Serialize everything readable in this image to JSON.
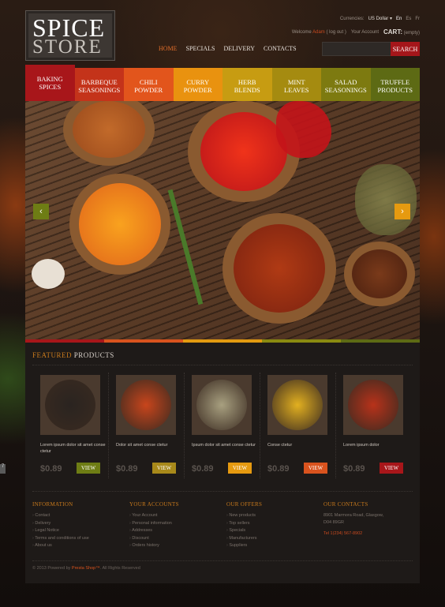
{
  "logo": {
    "line1": "SPICE",
    "line2": "STORE"
  },
  "topbar": {
    "currencies_label": "Currencies:",
    "currency_value": "US Dollar",
    "currency_chevron_icon": "chevron-down-icon",
    "languages": [
      "En",
      "Es",
      "Fr"
    ]
  },
  "userbar": {
    "welcome": "Welcome",
    "username": "Adam",
    "logout": "( log out )",
    "your_account": "Your Account",
    "cart_label": "CART:",
    "cart_state": "(empty)"
  },
  "nav": {
    "items": [
      "HOME",
      "SPECIALS",
      "DELIVERY",
      "CONTACTS"
    ],
    "active": "HOME"
  },
  "search": {
    "placeholder": "",
    "button": "SEARCH"
  },
  "categories": [
    {
      "line1": "BAKING",
      "line2": "SPICES",
      "color": "#a8161a"
    },
    {
      "line1": "BARBEQUE",
      "line2": "SEASONINGS",
      "color": "#c4331a"
    },
    {
      "line1": "CHILI",
      "line2": "POWDER",
      "color": "#e2551c"
    },
    {
      "line1": "CURRY",
      "line2": "POWDER",
      "color": "#e9920f"
    },
    {
      "line1": "HERB",
      "line2": "BLENDS",
      "color": "#c79c12"
    },
    {
      "line1": "MINT",
      "line2": "LEAVES",
      "color": "#a58b10"
    },
    {
      "line1": "SALAD",
      "line2": "SEASONINGS",
      "color": "#7d7a10"
    },
    {
      "line1": "TRUFFLE",
      "line2": "PRODUCTS",
      "color": "#5d6a14"
    }
  ],
  "slider": {
    "prev_icon": "chevron-left-icon",
    "next_icon": "chevron-right-icon",
    "prev_glyph": "‹",
    "next_glyph": "›"
  },
  "featured": {
    "title_a": "FEATURED",
    "title_b": " PRODUCTS",
    "products": [
      {
        "name": "Lorem ipsum dolor sit amet conse ctetur",
        "price": "$0.89",
        "view": "VIEW",
        "view_color": "#6e7d14",
        "spice": "black-pepper",
        "spice_color": "#2a2420"
      },
      {
        "name": "Dolor sit amet conse ctetur",
        "price": "$0.89",
        "view": "VIEW",
        "view_color": "#a8891a",
        "spice": "paprika",
        "spice_color": "#c8451c"
      },
      {
        "name": "Ipsum dolor sit amet conse ctetur",
        "price": "$0.89",
        "view": "VIEW",
        "view_color": "#e69a10",
        "spice": "dried-herbs",
        "spice_color": "#a8a080"
      },
      {
        "name": "Conse ctetur",
        "price": "$0.89",
        "view": "VIEW",
        "view_color": "#d9531e",
        "spice": "turmeric",
        "spice_color": "#e2b020"
      },
      {
        "name": "Lorem ipsum dolor",
        "price": "$0.89",
        "view": "VIEW",
        "view_color": "#a8161a",
        "spice": "saffron",
        "spice_color": "#b8321a"
      }
    ]
  },
  "footer": {
    "information": {
      "title": "INFORMATION",
      "items": [
        "Contact",
        "Delivery",
        "Legal Notice",
        "Terms and conditions of use",
        "About us"
      ]
    },
    "accounts": {
      "title": "YOUR ACCOUNTS",
      "items": [
        "Your Account",
        "Personal information",
        "Addresses",
        "Discount",
        "Orders history"
      ]
    },
    "offers": {
      "title": "OUR OFFERS",
      "items": [
        "New products",
        "Top sellers",
        "Specials",
        "Manufacturers",
        "Suppliers"
      ]
    },
    "contacts": {
      "title": "OUR CONTACTS",
      "address1": "8901 Marmora Road, Glasgow,",
      "address2": "D04 89GR",
      "tel": "Tel 1(234) 567-8902"
    }
  },
  "copyright": {
    "prefix": "© 2013 Powered by",
    "brand": "Presta Shop™",
    "suffix": ". All Rights Reserved"
  },
  "side_tab": "7"
}
